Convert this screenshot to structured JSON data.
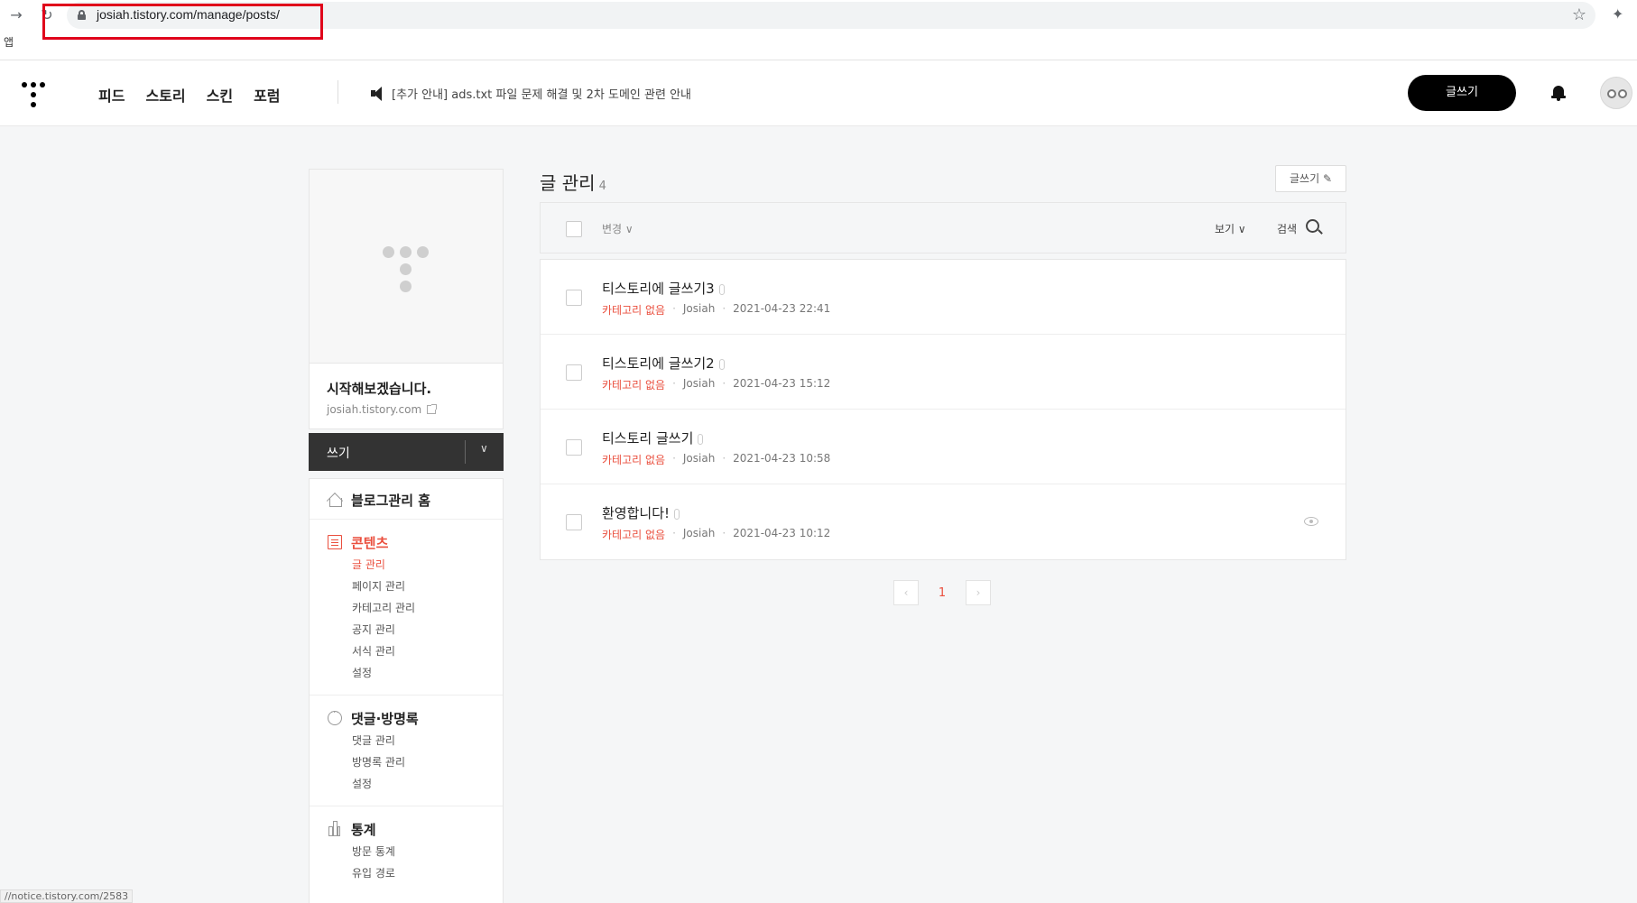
{
  "browser": {
    "url": "josiah.tistory.com/manage/posts/",
    "bookmarks_label": "앱",
    "status_url": "//notice.tistory.com/2583"
  },
  "header": {
    "nav": [
      "피드",
      "스토리",
      "스킨",
      "포럼"
    ],
    "notice": "[추가 안내] ads.txt 파일 문제 해결 및 2차 도메인 관련 안내",
    "write_label": "글쓰기"
  },
  "sidebar": {
    "blog_title": "시작해보겠습니다.",
    "blog_url": "josiah.tistory.com",
    "write_bar_label": "쓰기",
    "groups": [
      {
        "label": "블로그관리 홈",
        "icon": "home-icon",
        "items": []
      },
      {
        "label": "콘텐츠",
        "icon": "document-icon",
        "items": [
          "글 관리",
          "페이지 관리",
          "카테고리 관리",
          "공지 관리",
          "서식 관리",
          "설정"
        ]
      },
      {
        "label": "댓글·방명록",
        "icon": "comment-icon",
        "items": [
          "댓글 관리",
          "방명록 관리",
          "설정"
        ]
      },
      {
        "label": "통계",
        "icon": "chart-icon",
        "items": [
          "방문 통계",
          "유입 경로"
        ]
      }
    ],
    "active_item": "글 관리"
  },
  "main": {
    "title": "글 관리",
    "count": "4",
    "write_button": "글쓰기",
    "toolbar": {
      "change": "변경",
      "view": "보기",
      "search": "검색"
    },
    "posts": [
      {
        "title": "티스토리에 글쓰기3",
        "category": "카테고리 없음",
        "author": "Josiah",
        "date": "2021-04-23 22:41"
      },
      {
        "title": "티스토리에 글쓰기2",
        "category": "카테고리 없음",
        "author": "Josiah",
        "date": "2021-04-23 15:12"
      },
      {
        "title": "티스토리 글쓰기",
        "category": "카테고리 없음",
        "author": "Josiah",
        "date": "2021-04-23 10:58"
      },
      {
        "title": "환영합니다!",
        "category": "카테고리 없음",
        "author": "Josiah",
        "date": "2021-04-23 10:12"
      }
    ],
    "pagination": {
      "current": "1"
    }
  },
  "colors": {
    "accent": "#ea4f3e",
    "dark": "#333333",
    "highlight_box": "#e0001b"
  }
}
